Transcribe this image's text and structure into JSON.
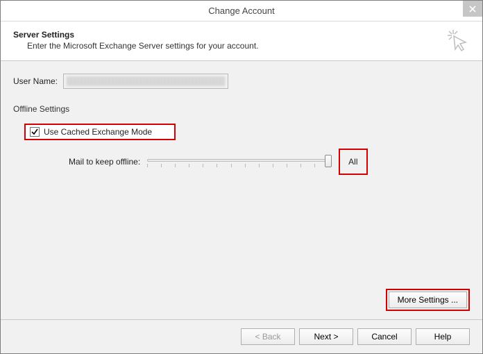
{
  "window": {
    "title": "Change Account"
  },
  "header": {
    "title": "Server Settings",
    "description": "Enter the Microsoft Exchange Server settings for your account."
  },
  "fields": {
    "user_name_label": "User Name:",
    "user_name_value": "(redacted)"
  },
  "offline": {
    "section_label": "Offline Settings",
    "cached_mode_label": "Use Cached Exchange Mode",
    "cached_mode_checked": true,
    "slider_label": "Mail to keep offline:",
    "slider_value": "All"
  },
  "buttons": {
    "more_settings": "More Settings ...",
    "back": "< Back",
    "next": "Next >",
    "cancel": "Cancel",
    "help": "Help"
  }
}
